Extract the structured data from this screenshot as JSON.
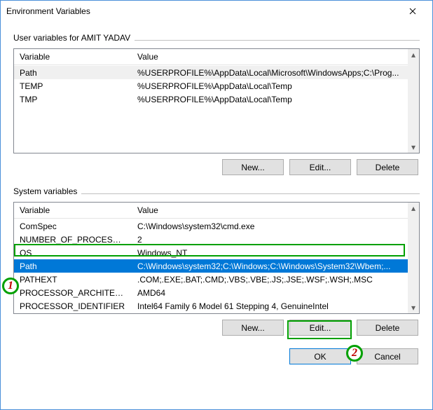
{
  "window": {
    "title": "Environment Variables"
  },
  "userSection": {
    "label": "User variables for AMIT YADAV",
    "columns": {
      "variable": "Variable",
      "value": "Value"
    },
    "rows": [
      {
        "variable": "Path",
        "value": "%USERPROFILE%\\AppData\\Local\\Microsoft\\WindowsApps;C:\\Prog..."
      },
      {
        "variable": "TEMP",
        "value": "%USERPROFILE%\\AppData\\Local\\Temp"
      },
      {
        "variable": "TMP",
        "value": "%USERPROFILE%\\AppData\\Local\\Temp"
      }
    ],
    "buttons": {
      "new": "New...",
      "edit": "Edit...",
      "delete": "Delete"
    }
  },
  "systemSection": {
    "label": "System variables",
    "columns": {
      "variable": "Variable",
      "value": "Value"
    },
    "rows": [
      {
        "variable": "ComSpec",
        "value": "C:\\Windows\\system32\\cmd.exe"
      },
      {
        "variable": "NUMBER_OF_PROCESSORS",
        "value": "2"
      },
      {
        "variable": "OS",
        "value": "Windows_NT"
      },
      {
        "variable": "Path",
        "value": "C:\\Windows\\system32;C:\\Windows;C:\\Windows\\System32\\Wbem;..."
      },
      {
        "variable": "PATHEXT",
        "value": ".COM;.EXE;.BAT;.CMD;.VBS;.VBE;.JS;.JSE;.WSF;.WSH;.MSC"
      },
      {
        "variable": "PROCESSOR_ARCHITECTURE",
        "value": "AMD64"
      },
      {
        "variable": "PROCESSOR_IDENTIFIER",
        "value": "Intel64 Family 6 Model 61 Stepping 4, GenuineIntel"
      }
    ],
    "selectedIndex": 3,
    "buttons": {
      "new": "New...",
      "edit": "Edit...",
      "delete": "Delete"
    }
  },
  "footer": {
    "ok": "OK",
    "cancel": "Cancel"
  },
  "annotations": {
    "badge1": "1",
    "badge2": "2"
  }
}
